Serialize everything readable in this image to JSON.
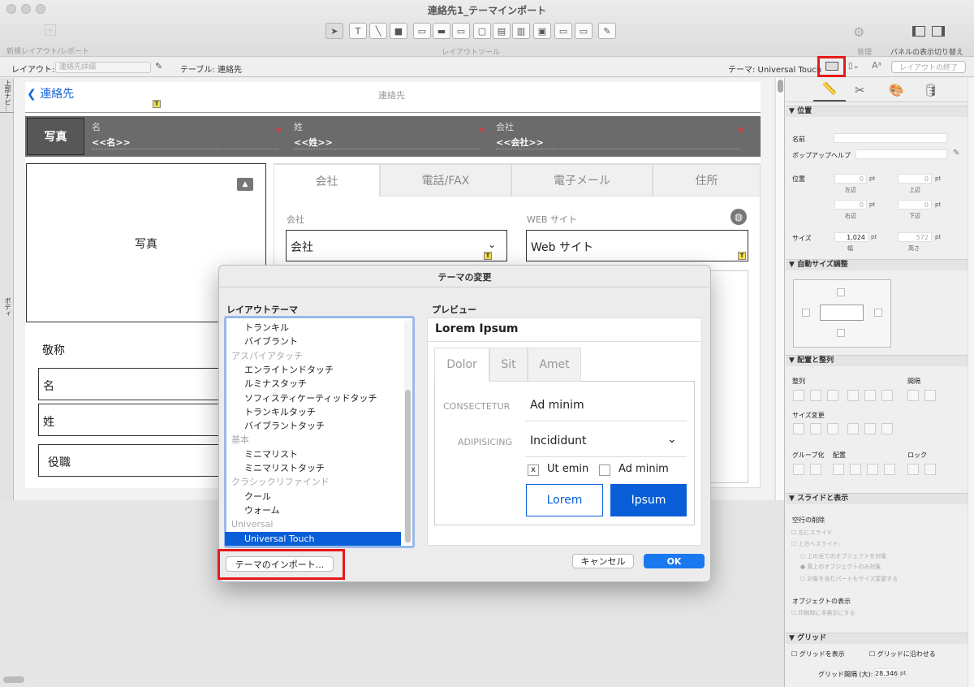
{
  "window": {
    "title": "連絡先1_テーマインポート"
  },
  "toolbar": {
    "new_layout_label": "新規レイアウト/レポート",
    "layout_tools_label": "レイアウトツール",
    "manage_label": "管理",
    "panel_toggle_label": "パネルの表示切り替え"
  },
  "layoutbar": {
    "layout_label": "レイアウト:",
    "layout_value": "連絡先詳細",
    "table_label": "テーブル: 連絡先",
    "theme_label": "テーマ: Universal Touch",
    "exit_layout": "レイアウトの終了"
  },
  "parts": {
    "top_nav": "上部ナビ...",
    "body": "ボディ"
  },
  "layout": {
    "back_label": "連絡先",
    "top_title": "連絡先",
    "header": {
      "photo": "写真",
      "first_name_label": "名",
      "first_name_value": "<<名>>",
      "last_name_label": "姓",
      "last_name_value": "<<姓>>",
      "company_label": "会社",
      "company_value": "<<会社>>"
    },
    "photo_box_label": "写真",
    "tabs": [
      "会社",
      "電話/FAX",
      "電子メール",
      "住所"
    ],
    "company_field_label": "会社",
    "company_field_value": "会社",
    "web_field_label": "WEB サイト",
    "web_field_value": "Web サイト",
    "honorific": "敬称",
    "first_name": "名",
    "last_name": "姓",
    "title": "役職"
  },
  "inspector": {
    "sections": {
      "position": "位置",
      "autosize": "自動サイズ調整",
      "arrange": "配置と整列",
      "slide": "スライドと表示",
      "grid": "グリッド"
    },
    "name_label": "名前",
    "popup_help_label": "ポップアップヘルプ",
    "position_label": "位置",
    "pos_fields": [
      {
        "value": "0",
        "unit": "pt",
        "caption": "左辺"
      },
      {
        "value": "0",
        "unit": "pt",
        "caption": "上辺"
      },
      {
        "value": "0",
        "unit": "pt",
        "caption": "右辺"
      },
      {
        "value": "0",
        "unit": "pt",
        "caption": "下辺"
      }
    ],
    "size_label": "サイズ",
    "width_value": "1,024",
    "width_unit": "pt",
    "width_caption": "幅",
    "height_value": "572",
    "height_unit": "pt",
    "height_caption": "高さ",
    "align_label": "整列",
    "spacing_label": "間隔",
    "resize_label": "サイズ変更",
    "group_label": "グループ化",
    "arrange_label": "配置",
    "lock_label": "ロック",
    "remove_blank_label": "空行の削除",
    "slide_left": "左にスライド",
    "slide_up": "上方へスライド:",
    "slide_opt1": "上の全てのオブジェクトを対象",
    "slide_opt2": "真上のオブジェクトのみ対象",
    "slide_opt3": "対象を含むパートもサイズ変更する",
    "object_display_label": "オブジェクトの表示",
    "hide_print": "印刷時に非表示にする",
    "show_grid": "グリッドを表示",
    "snap_grid": "グリッドに沿わせる",
    "grid_spacing_label": "グリッド間隔 (大):",
    "grid_spacing_value": "28.346",
    "grid_spacing_unit": "pt"
  },
  "dialog": {
    "title": "テーマの変更",
    "list_label": "レイアウトテーマ",
    "preview_label": "プレビュー",
    "themes": [
      {
        "label": "トランキル",
        "type": "item"
      },
      {
        "label": "バイブラント",
        "type": "item"
      },
      {
        "label": "アスパイアタッチ",
        "type": "head"
      },
      {
        "label": "エンライトンドタッチ",
        "type": "item"
      },
      {
        "label": "ルミナスタッチ",
        "type": "item"
      },
      {
        "label": "ソフィスティケーティッドタッチ",
        "type": "item"
      },
      {
        "label": "トランキルタッチ",
        "type": "item"
      },
      {
        "label": "バイブラントタッチ",
        "type": "item"
      },
      {
        "label": "基本",
        "type": "head"
      },
      {
        "label": "ミニマリスト",
        "type": "item"
      },
      {
        "label": "ミニマリストタッチ",
        "type": "item"
      },
      {
        "label": "クラシックリファインド",
        "type": "head"
      },
      {
        "label": "クール",
        "type": "item"
      },
      {
        "label": "ウォーム",
        "type": "item"
      },
      {
        "label": "Universal",
        "type": "head"
      },
      {
        "label": "Universal Touch",
        "type": "selected"
      }
    ],
    "preview": {
      "title": "Lorem Ipsum",
      "tabs": [
        "Dolor",
        "Sit",
        "Amet"
      ],
      "row1_label": "CONSECTETUR",
      "row1_value": "Ad minim",
      "row2_label": "ADIPISICING",
      "row2_value": "Incididunt",
      "check1": "Ut emin",
      "check1_mark": "x",
      "check2": "Ad minim",
      "btn1": "Lorem",
      "btn2": "Ipsum"
    },
    "import_button": "テーマのインポート...",
    "cancel_button": "キャンセル",
    "ok_button": "OK"
  },
  "colors": {
    "accent": "#0a5fd8",
    "highlight": "#e51a1a"
  }
}
